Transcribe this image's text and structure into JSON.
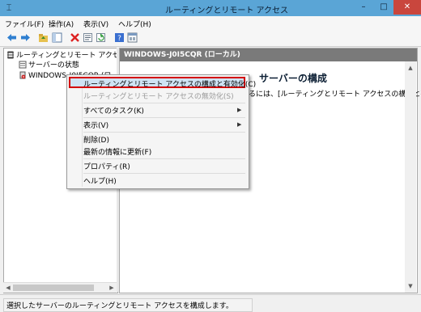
{
  "window": {
    "title": "ルーティングとリモート アクセス",
    "app_icon": "server-manager-icon",
    "controls": {
      "minimize": "–",
      "maximize": "□",
      "close": "✕"
    }
  },
  "menubar": [
    "ファイル(F)",
    "操作(A)",
    "表示(V)",
    "ヘルプ(H)"
  ],
  "toolbar": [
    "back-arrow-icon",
    "forward-arrow-icon",
    "folder-up-icon",
    "show-hide-tree-icon",
    "delete-icon",
    "properties-icon",
    "refresh-icon",
    "help-icon",
    "console-icon"
  ],
  "tree": {
    "root": "ルーティングとリモート アクセス",
    "items": [
      "サーバーの状態",
      "WINDOWS-J0I5CQR (ロー"
    ]
  },
  "right_pane": {
    "header": "WINDOWS-J0I5CQR (ローカル)",
    "heading": "ルーティングとリモート アクセス サーバーの構成",
    "heading_visible_part": "サーバーの構成",
    "description": "するには、[ルーティングとリモート アクセスの構成と有"
  },
  "context_menu": {
    "items": [
      {
        "label": "ルーティングとリモート アクセスの構成と有効化(C)",
        "state": "highlighted"
      },
      {
        "label": "ルーティングとリモート アクセスの無効化(S)",
        "state": "disabled"
      },
      {
        "label": "すべてのタスク(K)",
        "submenu": true
      },
      {
        "label": "表示(V)",
        "submenu": true
      },
      {
        "label": "削除(D)"
      },
      {
        "label": "最新の情報に更新(F)"
      },
      {
        "label": "プロパティ(R)"
      },
      {
        "label": "ヘルプ(H)"
      }
    ],
    "highlight_border_color": "#d30000"
  },
  "statusbar": "選択したサーバーのルーティングとリモート アクセスを構成します。",
  "colors": {
    "titlebar": "#5aa5d6",
    "pane_header": "#7a7a7a",
    "close_button": "#c9463d"
  }
}
